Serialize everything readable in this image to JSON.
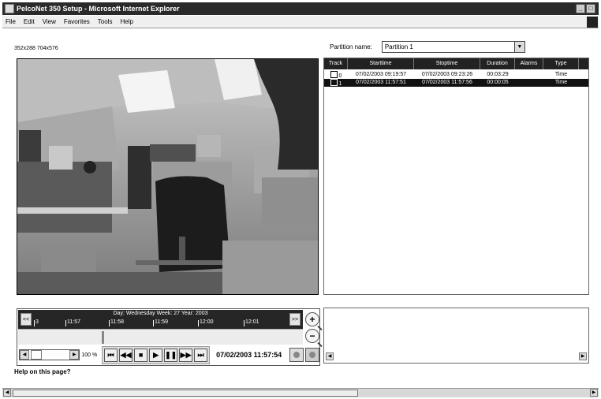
{
  "window": {
    "title": "PelcoNet 350 Setup - Microsoft Internet Explorer"
  },
  "menu": [
    "File",
    "Edit",
    "View",
    "Favorites",
    "Tools",
    "Help"
  ],
  "resolution_links": [
    "352x288",
    "704x576"
  ],
  "partition": {
    "label": "Partition name:",
    "value": "Partition 1"
  },
  "track_table": {
    "headers": [
      "Track",
      "Starttime",
      "Stoptime",
      "Duration",
      "Alarms",
      "Type"
    ],
    "rows": [
      {
        "track": "0",
        "start": "07/02/2003 09:19:57",
        "stop": "07/02/2003 09:23:26",
        "duration": "00:03:29",
        "alarms": "",
        "type": "Time",
        "selected": false
      },
      {
        "track": "1",
        "start": "07/02/2003 11:57:51",
        "stop": "07/02/2003 11:57:56",
        "duration": "00:00:05",
        "alarms": "",
        "type": "Time",
        "selected": true
      }
    ]
  },
  "timeline": {
    "day_label": "Day: Wednesday Week: 27 Year: 2003",
    "ticks": [
      "3",
      "11:57",
      "11:58",
      "11:59",
      "12:00",
      "12:01"
    ],
    "prev": "<<",
    "next": ">>"
  },
  "playback": {
    "speed_percent": "100 %",
    "datetime": "07/02/2003 11:57:54"
  },
  "help_text": "Help on this page?"
}
